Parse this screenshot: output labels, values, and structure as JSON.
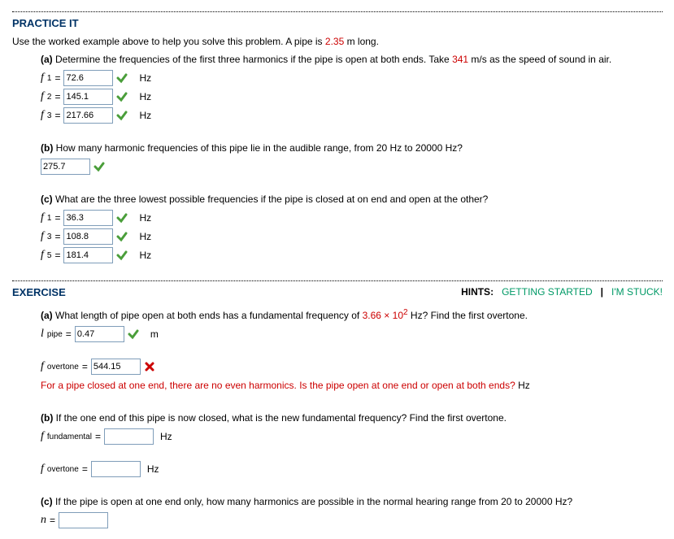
{
  "practice": {
    "title": "PRACTICE IT",
    "intro_pre": "Use the worked example above to help you solve this problem. A pipe is ",
    "pipe_len": "2.35",
    "intro_post": " m long.",
    "a": {
      "label": "(a)",
      "text_pre": " Determine the frequencies of the first three harmonics if the pipe is open at both ends. Take ",
      "speed": "341",
      "text_post": " m/s as the speed of sound in air.",
      "rows": [
        {
          "var": "f",
          "sub": "1",
          "val": "72.6",
          "unit": "Hz"
        },
        {
          "var": "f",
          "sub": "2",
          "val": "145.1",
          "unit": "Hz"
        },
        {
          "var": "f",
          "sub": "3",
          "val": "217.66",
          "unit": "Hz"
        }
      ]
    },
    "b": {
      "label": "(b)",
      "text": " How many harmonic frequencies of this pipe lie in the audible range, from 20 Hz to 20000 Hz?",
      "val": "275.7"
    },
    "c": {
      "label": "(c)",
      "text": " What are the three lowest possible frequencies if the pipe is closed at on end and open at the other?",
      "rows": [
        {
          "var": "f",
          "sub": "1",
          "val": "36.3",
          "unit": "Hz"
        },
        {
          "var": "f",
          "sub": "3",
          "val": "108.8",
          "unit": "Hz"
        },
        {
          "var": "f",
          "sub": "5",
          "val": "181.4",
          "unit": "Hz"
        }
      ]
    }
  },
  "exercise": {
    "title": "EXERCISE",
    "hints_label": "HINTS:",
    "getting_started": "GETTING STARTED",
    "divider": "|",
    "stuck": "I'M STUCK!",
    "a": {
      "label": "(a)",
      "text_pre": " What length of pipe open at both ends has a fundamental frequency of ",
      "freq_base": "3.66",
      "freq_times": " × 10",
      "freq_exp": "2",
      "text_post": " Hz? Find the first overtone.",
      "l_var": "l",
      "l_sub": "pipe",
      "l_val": "0.47",
      "l_unit": "m",
      "f_var": "f",
      "f_sub": "overtone",
      "f_val": "544.15",
      "feedback": "For a pipe closed at one end, there are no even harmonics. Is the pipe open at one end or open at both ends?",
      "feedback_unit": " Hz"
    },
    "b": {
      "label": "(b)",
      "text": " If the one end of this pipe is now closed, what is the new fundamental frequency? Find the first overtone.",
      "fund_var": "f",
      "fund_sub": "fundamental",
      "fund_val": "",
      "fund_unit": "Hz",
      "over_var": "f",
      "over_sub": "overtone",
      "over_val": "",
      "over_unit": "Hz"
    },
    "c": {
      "label": "(c)",
      "text": " If the pipe is open at one end only, how many harmonics are possible in the normal hearing range from 20 to 20000 Hz?",
      "n_var": "n",
      "n_val": ""
    }
  }
}
